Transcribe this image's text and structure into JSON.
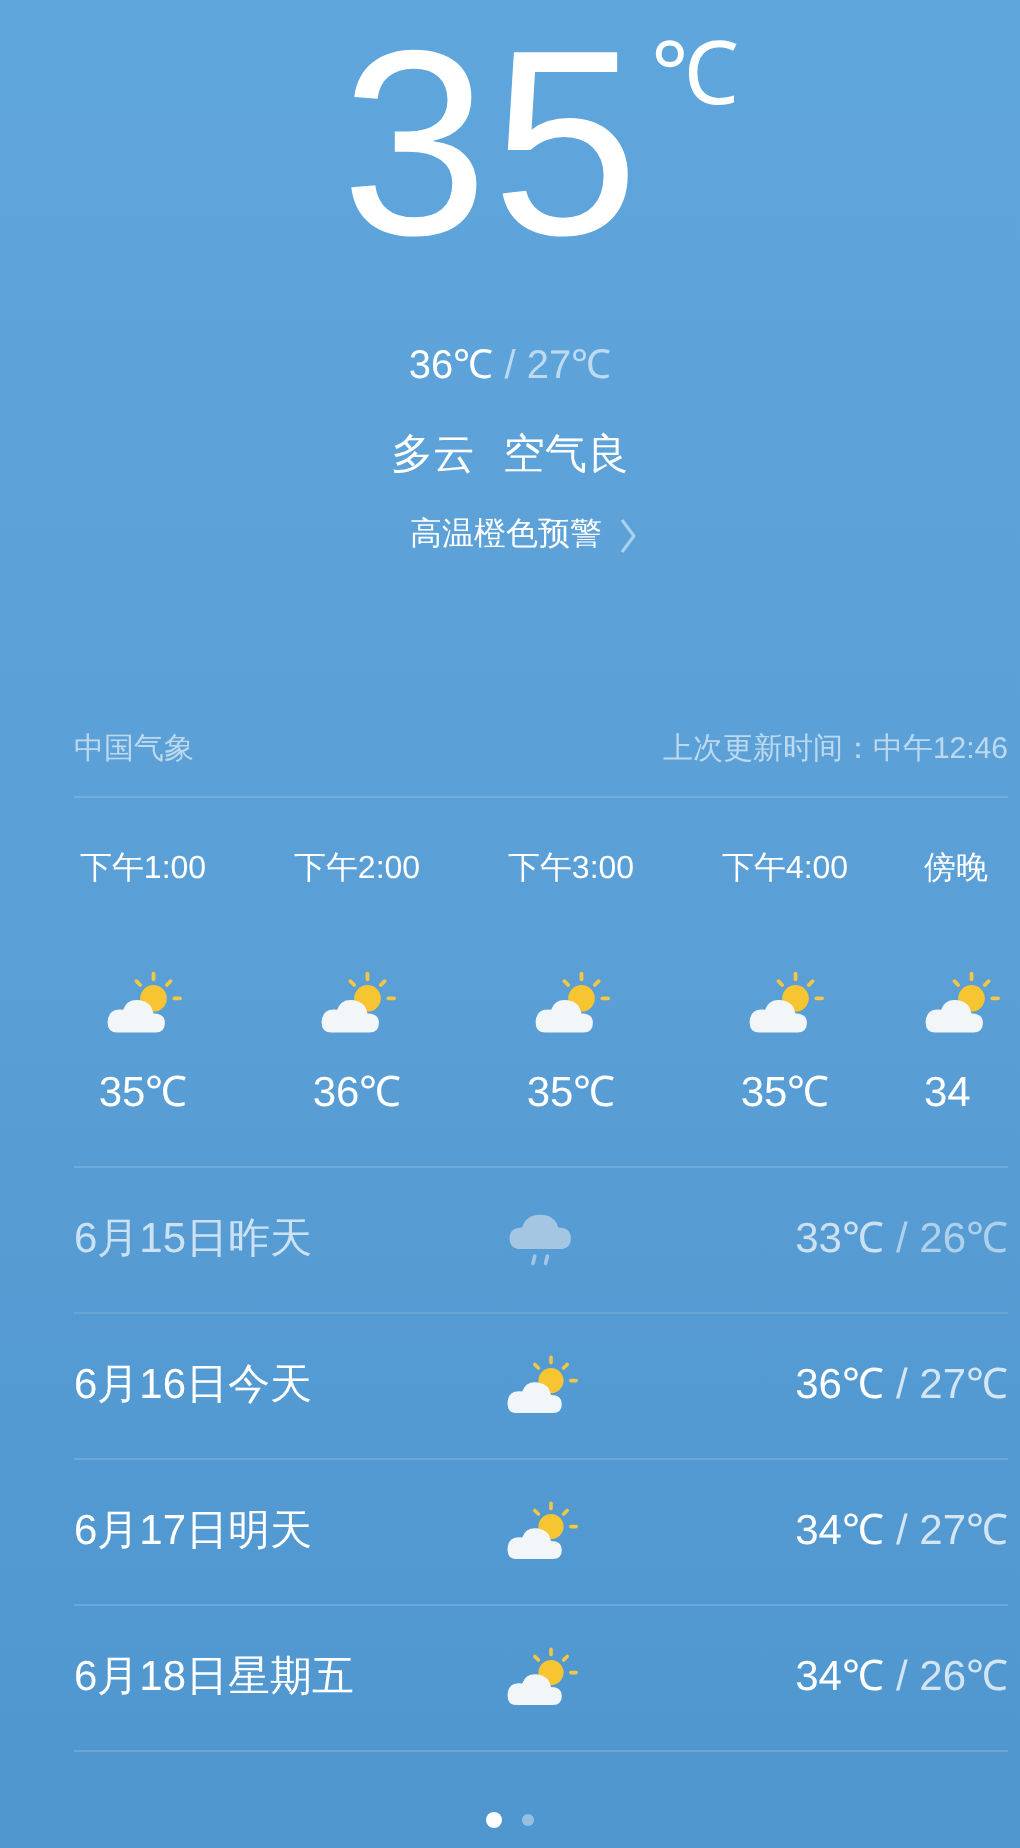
{
  "current": {
    "temperature": "35",
    "unit": "℃",
    "high": "36℃",
    "low": "/ 27℃",
    "condition": "多云",
    "air_quality": "空气良",
    "alert": "高温橙色预警"
  },
  "source": {
    "provider": "中国气象",
    "updated": "上次更新时间：中午12:46"
  },
  "hourly": [
    {
      "time": "下午1:00",
      "kind": "partly_cloudy",
      "temperature": "35℃"
    },
    {
      "time": "下午2:00",
      "kind": "partly_cloudy",
      "temperature": "36℃"
    },
    {
      "time": "下午3:00",
      "kind": "partly_cloudy",
      "temperature": "35℃"
    },
    {
      "time": "下午4:00",
      "kind": "partly_cloudy",
      "temperature": "35℃"
    },
    {
      "time": "傍晚",
      "kind": "partly_cloudy",
      "temperature": "34"
    }
  ],
  "daily": [
    {
      "date": "6月15日昨天",
      "kind": "rain",
      "high": "33℃",
      "low": "/ 26℃",
      "past": true
    },
    {
      "date": "6月16日今天",
      "kind": "partly_cloudy",
      "high": "36℃",
      "low": "/ 27℃",
      "past": false
    },
    {
      "date": "6月17日明天",
      "kind": "partly_cloudy",
      "high": "34℃",
      "low": "/ 27℃",
      "past": false
    },
    {
      "date": "6月18日星期五",
      "kind": "partly_cloudy",
      "high": "34℃",
      "low": "/ 26℃",
      "past": false
    }
  ],
  "pages": [
    {
      "selected": true
    },
    {
      "selected": false
    }
  ]
}
